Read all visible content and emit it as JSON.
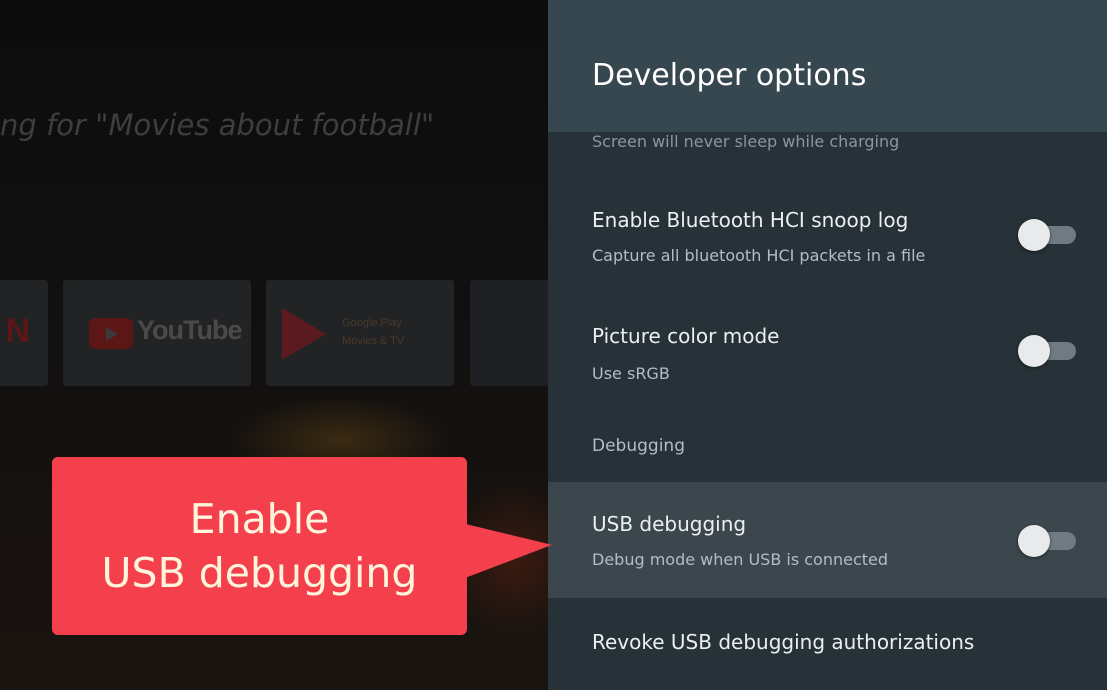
{
  "background": {
    "search_text": "ing for \"Movies about football\"",
    "apps": [
      {
        "name": "Netflix",
        "glyph": "N"
      },
      {
        "name": "YouTube",
        "label": "YouTube"
      },
      {
        "name": "Google Play Movies & TV",
        "label_line1": "Google Play",
        "label_line2": "Movies & TV"
      }
    ]
  },
  "callout": {
    "line1": "Enable",
    "line2": "USB debugging",
    "color": "#f4404d"
  },
  "panel": {
    "title": "Developer options",
    "items": [
      {
        "title": "",
        "subtitle": "Screen will never sleep while charging",
        "toggle": "on",
        "partial": true
      },
      {
        "title": "Enable Bluetooth HCI snoop log",
        "subtitle": "Capture all bluetooth HCI packets in a file",
        "toggle": "off"
      },
      {
        "title": "Picture color mode",
        "subtitle": "Use sRGB",
        "toggle": "off"
      }
    ],
    "section": "Debugging",
    "focused_item": {
      "title": "USB debugging",
      "subtitle": "Debug mode when USB is connected",
      "toggle": "off"
    },
    "last_item": {
      "title": "Revoke USB debugging authorizations"
    }
  },
  "colors": {
    "panel_bg": "#263238",
    "header_bg": "#37474f",
    "focused_row_bg": "#3b474d",
    "callout_red": "#f4404d"
  }
}
